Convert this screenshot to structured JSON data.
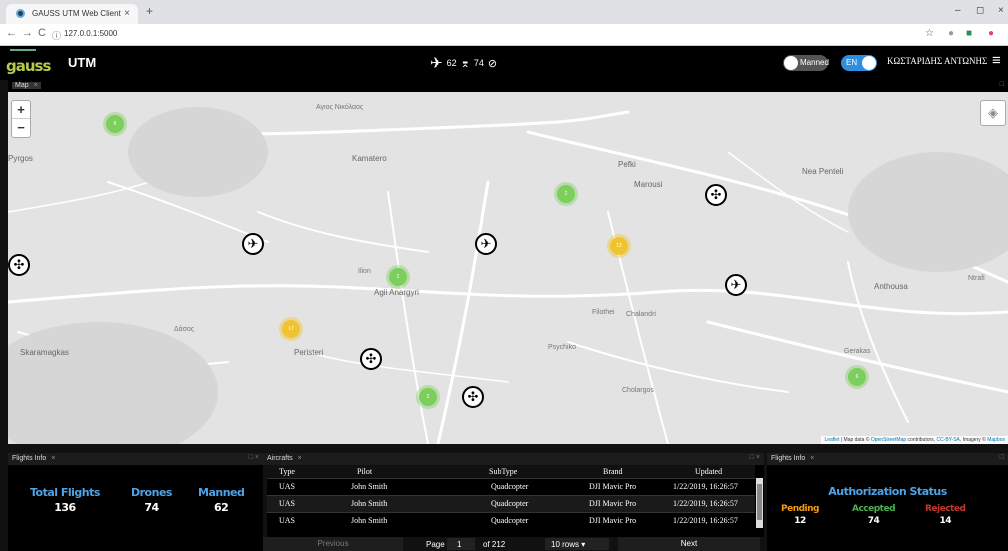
{
  "browser": {
    "tab_title": "GAUSS UTM Web Client",
    "tab_close": "×",
    "new_tab": "+",
    "url": "127.0.0.1:5000",
    "win_min": "–",
    "win_max": "◻",
    "win_close": "×"
  },
  "app": {
    "logo": "gauss",
    "title": "UTM",
    "stats": {
      "manned_count": "62",
      "drones_count": "74"
    },
    "manned_toggle": "Manned",
    "lang_toggle": "EN",
    "user": "ΚΩΣΤΑΡΙΔΗΣ ΑΝΤΩΝΗΣ"
  },
  "map_panel": {
    "tab": "Map",
    "close": "×",
    "ctl": "□",
    "zoom_in": "+",
    "zoom_out": "−",
    "places": [
      {
        "name": "Agios Nikolaos",
        "label": "Αγιος Νικόλαος"
      },
      {
        "name": "Kamatero",
        "label": "Kamatero"
      },
      {
        "name": "Pefki",
        "label": "Pefki"
      },
      {
        "name": "Marousi",
        "label": "Marousi"
      },
      {
        "name": "Nea Penteli",
        "label": "Nea Penteli"
      },
      {
        "name": "Pyrgos",
        "label": "Pyrgos"
      },
      {
        "name": "Ilion",
        "label": "Ilion"
      },
      {
        "name": "Agii Anargyri",
        "label": "Agii Anargyri"
      },
      {
        "name": "Anthousa",
        "label": "Anthousa"
      },
      {
        "name": "Filothei",
        "label": "Filothei"
      },
      {
        "name": "Chalandri",
        "label": "Chalandri"
      },
      {
        "name": "Dasos",
        "label": "Δάσος"
      },
      {
        "name": "Skaramagkas",
        "label": "Skaramagkas"
      },
      {
        "name": "Peristeri",
        "label": "Peristeri"
      },
      {
        "name": "Psychiko",
        "label": "Psychiko"
      },
      {
        "name": "Cholargos",
        "label": "Cholargos"
      },
      {
        "name": "Gerakas",
        "label": "Gerakas"
      },
      {
        "name": "Ntrafi",
        "label": "Ntrafi"
      }
    ],
    "clusters": [
      {
        "count": "6"
      },
      {
        "count": "2"
      },
      {
        "count": "12"
      },
      {
        "count": "2"
      },
      {
        "count": "17"
      },
      {
        "count": "2"
      },
      {
        "count": "6"
      }
    ],
    "attribution_prefix": "Leaflet",
    "attribution_text": " | Map data © ",
    "attribution_osm": "OpenStreetMap",
    "attribution_mid": " contributors, ",
    "attribution_cc": "CC-BY-SA",
    "attribution_end": ", Imagery © ",
    "attribution_mb": "Mapbox"
  },
  "flights_info": {
    "tab": "Flights Info",
    "close": "×",
    "ctl": "□ ×",
    "total_label": "Total Flights",
    "total_value": "136",
    "drones_label": "Drones",
    "drones_value": "74",
    "manned_label": "Manned",
    "manned_value": "62"
  },
  "aircrafts": {
    "tab": "Aircrafts",
    "close": "×",
    "ctl": "□ ×",
    "columns": [
      "Type",
      "Pilot",
      "SubType",
      "Brand",
      "Updated"
    ],
    "rows": [
      [
        "UAS",
        "John Smith",
        "Quadcopter",
        "DJI Mavic Pro",
        "1/22/2019, 16:26:57"
      ],
      [
        "UAS",
        "John Smith",
        "Quadcopter",
        "DJI Mavic Pro",
        "1/22/2019, 16:26:57"
      ],
      [
        "UAS",
        "John Smith",
        "Quadcopter",
        "DJI Mavic Pro",
        "1/22/2019, 16:26:57"
      ]
    ],
    "previous": "Previous",
    "page_label": "Page",
    "page_value": "1",
    "of_pages": "of 212",
    "rows_select": "10 rows",
    "next": "Next"
  },
  "auth_info": {
    "tab": "Flights Info",
    "close": "×",
    "ctl": "□",
    "title": "Authorization Status",
    "pending_label": "Pending",
    "pending_value": "12",
    "accepted_label": "Accepted",
    "accepted_value": "74",
    "rejected_label": "Rejected",
    "rejected_value": "14"
  },
  "colors": {
    "accent_blue": "#4ea3e6",
    "pending": "#f39c12",
    "accepted": "#4caf50",
    "rejected": "#c0392b",
    "cluster_green": "#7ccf5c",
    "cluster_yellow": "#f0c430"
  }
}
